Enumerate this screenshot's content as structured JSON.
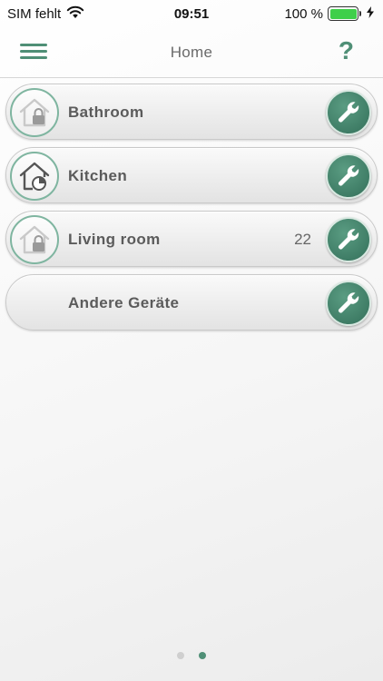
{
  "status_bar": {
    "carrier": "SIM fehlt",
    "time": "09:51",
    "battery_text": "100 %",
    "battery_level": 1.0,
    "icons": [
      "wifi-icon",
      "battery-icon",
      "charging-bolt-icon"
    ]
  },
  "navbar": {
    "title": "Home",
    "menu_icon": "hamburger-menu-icon",
    "help_label": "?"
  },
  "rooms": [
    {
      "label": "Bathroom",
      "count": "",
      "icon": "house-lock-icon"
    },
    {
      "label": "Kitchen",
      "count": "",
      "icon": "house-clock-icon"
    },
    {
      "label": "Living room",
      "count": "22",
      "icon": "house-lock-icon"
    },
    {
      "label": "Andere Geräte",
      "count": "",
      "icon": ""
    }
  ],
  "action_icon": "wrench-icon",
  "pager": {
    "pages": 2,
    "current": 2
  },
  "colors": {
    "accent": "#4f8f76",
    "wrench_button": "#3f7d66",
    "battery_green": "#3fcf4a",
    "ring": "#7fb5a0"
  }
}
